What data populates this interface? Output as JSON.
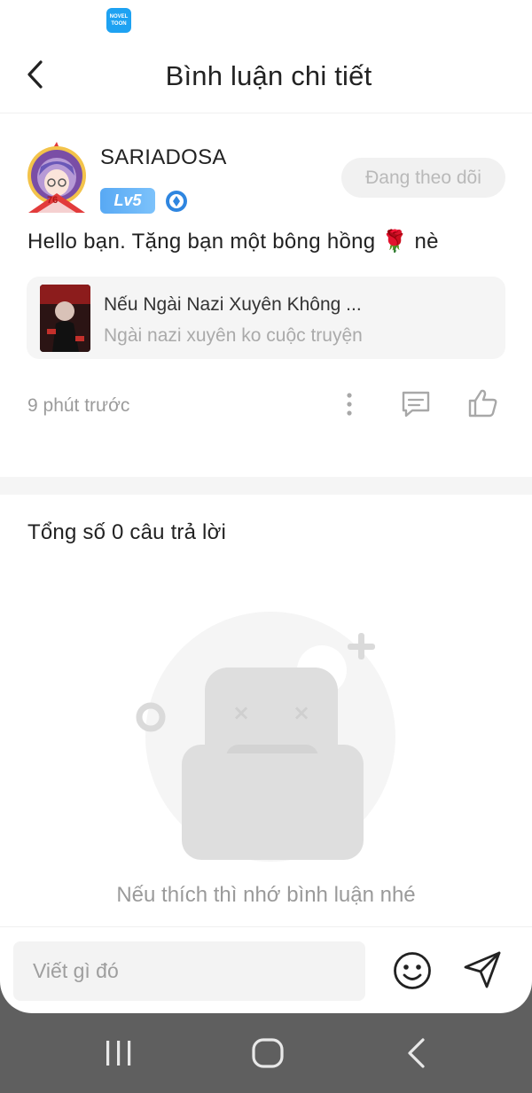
{
  "status_bar": {
    "app_icon_text": "NOVEL TOON"
  },
  "header": {
    "title": "Bình luận chi tiết"
  },
  "comment": {
    "username": "SARIADOSA",
    "avatar_badge": "76",
    "level": "Lv5",
    "follow_label": "Đang theo dõi",
    "text": "Hello bạn. Tặng bạn một bông hồng 🌹 nè",
    "book": {
      "title": "Nếu Ngài Nazi Xuyên Không ...",
      "subtitle": "Ngài nazi xuyên ko cuộc truyện"
    },
    "time": "9 phút trước"
  },
  "replies": {
    "total_label": "Tổng số 0 câu trả lời",
    "empty_message": "Nếu thích thì nhớ bình luận nhé"
  },
  "input": {
    "placeholder": "Viết gì đó"
  },
  "icons": {
    "back": "back-arrow-icon",
    "more": "more-vertical-icon",
    "reply": "comment-icon",
    "like": "thumbs-up-icon",
    "emoji": "smiley-icon",
    "send": "send-icon"
  },
  "colors": {
    "level_badge": "#58a9f4",
    "follow_bg": "#f1f1f1",
    "follow_text": "#b9b9b9",
    "app_icon": "#1ea2f2",
    "nav_bar": "#5f5f5f"
  }
}
